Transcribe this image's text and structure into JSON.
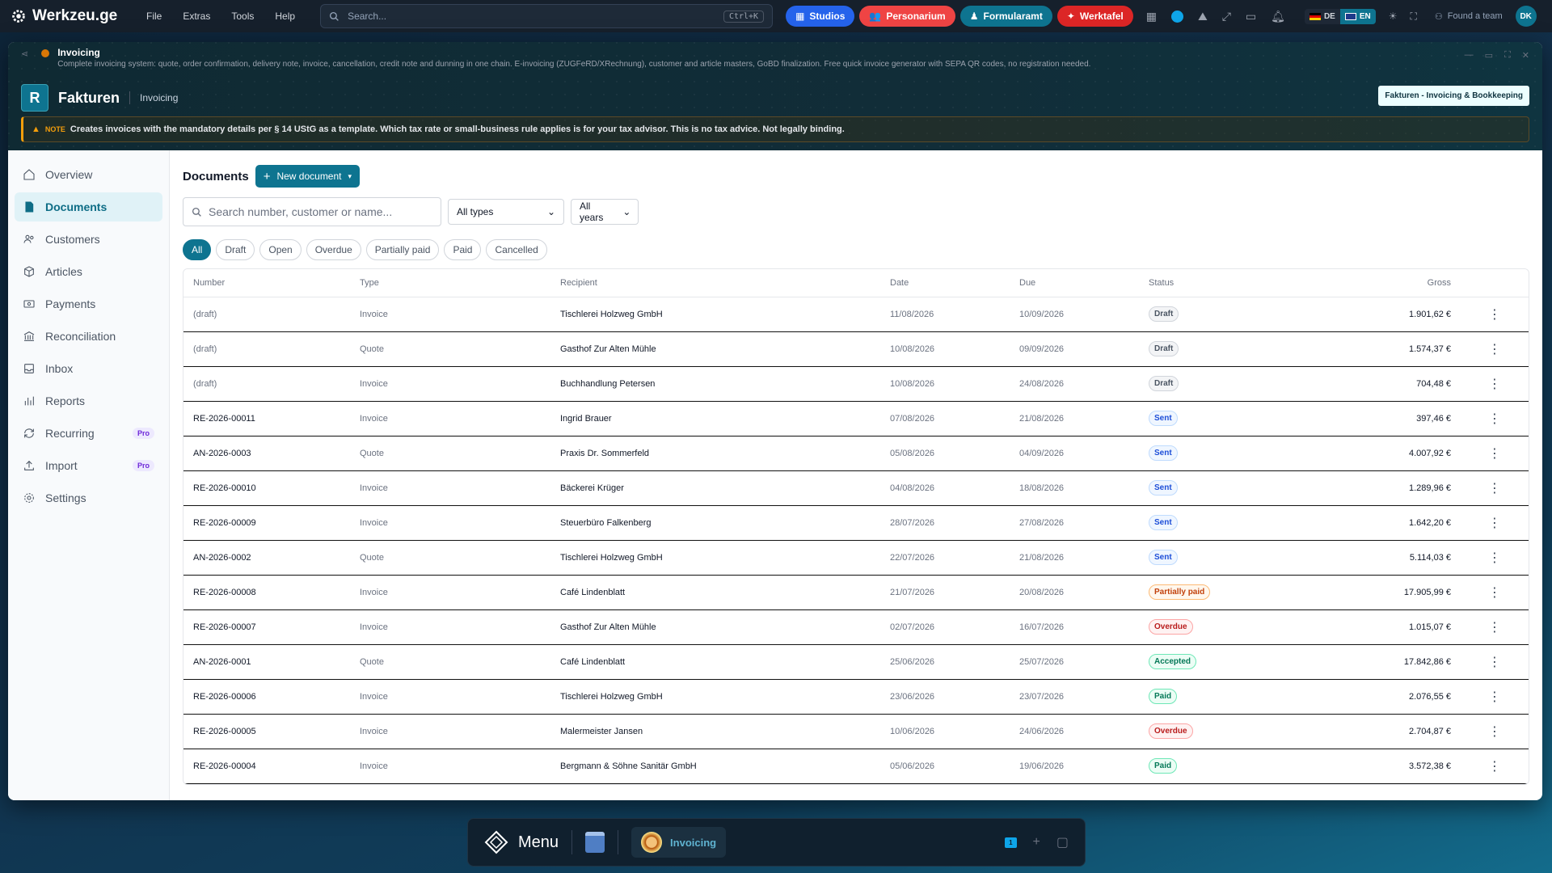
{
  "topbar": {
    "brand": "Werkzeu.ge",
    "menu": [
      "File",
      "Extras",
      "Tools",
      "Help"
    ],
    "search_placeholder": "Search...",
    "search_shortcut": "Ctrl+K",
    "pills": [
      {
        "label": "Studios",
        "color": "#2563eb"
      },
      {
        "label": "Personarium",
        "color": "#ef4444"
      },
      {
        "label": "Formularamt",
        "color": "#0e7490"
      },
      {
        "label": "Werktafel",
        "color": "#dc2626"
      }
    ],
    "lang_de": "DE",
    "lang_en": "EN",
    "team_label": "Found a team",
    "avatar": "DK"
  },
  "window": {
    "title": "Invoicing",
    "subtitle": "Complete invoicing system: quote, order confirmation, delivery note, invoice, cancellation, credit note and dunning in one chain. E-invoicing (ZUGFeRD/XRechnung), customer and article masters, GoBD finalization. Free quick invoice generator with SEPA QR codes, no registration needed.",
    "app_letter": "R",
    "app_name": "Fakturen",
    "app_section": "Invoicing",
    "brand_button": "Fakturen - Invoicing & Bookkeeping",
    "note_label": "NOTE",
    "note_text": "Creates invoices with the mandatory details per § 14 UStG as a template. Which tax rate or small-business rule applies is for your tax advisor. This is no tax advice. Not legally binding."
  },
  "sidebar": {
    "items": [
      {
        "label": "Overview",
        "icon": "home-icon"
      },
      {
        "label": "Documents",
        "icon": "document-icon",
        "active": true
      },
      {
        "label": "Customers",
        "icon": "users-icon"
      },
      {
        "label": "Articles",
        "icon": "box-icon"
      },
      {
        "label": "Payments",
        "icon": "cash-icon"
      },
      {
        "label": "Reconciliation",
        "icon": "bank-icon"
      },
      {
        "label": "Inbox",
        "icon": "inbox-icon"
      },
      {
        "label": "Reports",
        "icon": "chart-icon"
      },
      {
        "label": "Recurring",
        "icon": "repeat-icon",
        "badge": "Pro"
      },
      {
        "label": "Import",
        "icon": "upload-icon",
        "badge": "Pro"
      },
      {
        "label": "Settings",
        "icon": "gear-icon"
      }
    ]
  },
  "main": {
    "title": "Documents",
    "new_button": "New document",
    "search_placeholder": "Search number, customer or name...",
    "type_select": "All types",
    "year_select": "All years",
    "chips": [
      "All",
      "Draft",
      "Open",
      "Overdue",
      "Partially paid",
      "Paid",
      "Cancelled"
    ],
    "columns": [
      "Number",
      "Type",
      "Recipient",
      "Date",
      "Due",
      "Status",
      "Gross"
    ],
    "rows": [
      {
        "number": "(draft)",
        "type": "Invoice",
        "recipient": "Tischlerei Holzweg GmbH",
        "date": "11/08/2026",
        "due": "10/09/2026",
        "status": "Draft",
        "gross": "1.901,62 €"
      },
      {
        "number": "(draft)",
        "type": "Quote",
        "recipient": "Gasthof Zur Alten Mühle",
        "date": "10/08/2026",
        "due": "09/09/2026",
        "status": "Draft",
        "gross": "1.574,37 €"
      },
      {
        "number": "(draft)",
        "type": "Invoice",
        "recipient": "Buchhandlung Petersen",
        "date": "10/08/2026",
        "due": "24/08/2026",
        "status": "Draft",
        "gross": "704,48 €"
      },
      {
        "number": "RE-2026-00011",
        "type": "Invoice",
        "recipient": "Ingrid Brauer",
        "date": "07/08/2026",
        "due": "21/08/2026",
        "status": "Sent",
        "gross": "397,46 €"
      },
      {
        "number": "AN-2026-0003",
        "type": "Quote",
        "recipient": "Praxis Dr. Sommerfeld",
        "date": "05/08/2026",
        "due": "04/09/2026",
        "status": "Sent",
        "gross": "4.007,92 €"
      },
      {
        "number": "RE-2026-00010",
        "type": "Invoice",
        "recipient": "Bäckerei Krüger",
        "date": "04/08/2026",
        "due": "18/08/2026",
        "status": "Sent",
        "gross": "1.289,96 €"
      },
      {
        "number": "RE-2026-00009",
        "type": "Invoice",
        "recipient": "Steuerbüro Falkenberg",
        "date": "28/07/2026",
        "due": "27/08/2026",
        "status": "Sent",
        "gross": "1.642,20 €"
      },
      {
        "number": "AN-2026-0002",
        "type": "Quote",
        "recipient": "Tischlerei Holzweg GmbH",
        "date": "22/07/2026",
        "due": "21/08/2026",
        "status": "Sent",
        "gross": "5.114,03 €"
      },
      {
        "number": "RE-2026-00008",
        "type": "Invoice",
        "recipient": "Café Lindenblatt",
        "date": "21/07/2026",
        "due": "20/08/2026",
        "status": "Partially paid",
        "gross": "17.905,99 €"
      },
      {
        "number": "RE-2026-00007",
        "type": "Invoice",
        "recipient": "Gasthof Zur Alten Mühle",
        "date": "02/07/2026",
        "due": "16/07/2026",
        "status": "Overdue",
        "gross": "1.015,07 €"
      },
      {
        "number": "AN-2026-0001",
        "type": "Quote",
        "recipient": "Café Lindenblatt",
        "date": "25/06/2026",
        "due": "25/07/2026",
        "status": "Accepted",
        "gross": "17.842,86 €"
      },
      {
        "number": "RE-2026-00006",
        "type": "Invoice",
        "recipient": "Tischlerei Holzweg GmbH",
        "date": "23/06/2026",
        "due": "23/07/2026",
        "status": "Paid",
        "gross": "2.076,55 €"
      },
      {
        "number": "RE-2026-00005",
        "type": "Invoice",
        "recipient": "Malermeister Jansen",
        "date": "10/06/2026",
        "due": "24/06/2026",
        "status": "Overdue",
        "gross": "2.704,87 €"
      },
      {
        "number": "RE-2026-00004",
        "type": "Invoice",
        "recipient": "Bergmann & Söhne Sanitär GmbH",
        "date": "05/06/2026",
        "due": "19/06/2026",
        "status": "Paid",
        "gross": "3.572,38 €"
      }
    ],
    "status_colors": {
      "Draft": {
        "fg": "#4b5563",
        "bg": "#f3f4f6",
        "border": "#d1d5db"
      },
      "Sent": {
        "fg": "#1d4ed8",
        "bg": "#eff6ff",
        "border": "#bfdbfe"
      },
      "Partially paid": {
        "fg": "#c2410c",
        "bg": "#fff7ed",
        "border": "#fdba74"
      },
      "Overdue": {
        "fg": "#b91c1c",
        "bg": "#fef2f2",
        "border": "#fca5a5"
      },
      "Accepted": {
        "fg": "#047857",
        "bg": "#ecfdf5",
        "border": "#6ee7b7"
      },
      "Paid": {
        "fg": "#047857",
        "bg": "#ecfdf5",
        "border": "#6ee7b7"
      }
    }
  },
  "dock": {
    "menu_label": "Menu",
    "app_label": "Invoicing",
    "workspace_number": "1"
  }
}
